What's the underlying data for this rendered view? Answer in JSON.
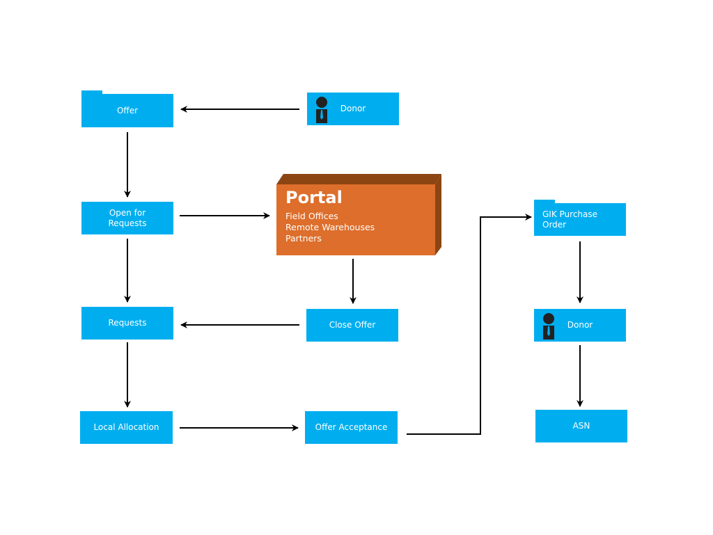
{
  "colors": {
    "node": "#00aeef",
    "portal_front": "#dd6e2b",
    "portal_side": "#8b4513",
    "arrow": "#000000"
  },
  "nodes": {
    "offer": "Offer",
    "donor_top": "Donor",
    "open_for_requests": "Open for\nRequests",
    "requests": "Requests",
    "close_offer": "Close Offer",
    "local_allocation": "Local Allocation",
    "offer_acceptance": "Offer Acceptance",
    "gik_purchase_order": "GIK Purchase\nOrder",
    "donor_right": "Donor",
    "asn": "ASN"
  },
  "portal": {
    "title": "Portal",
    "items": [
      "Field Offices",
      "Remote Warehouses",
      "Partners"
    ]
  },
  "icons": {
    "donor": "person-with-tie-icon"
  }
}
